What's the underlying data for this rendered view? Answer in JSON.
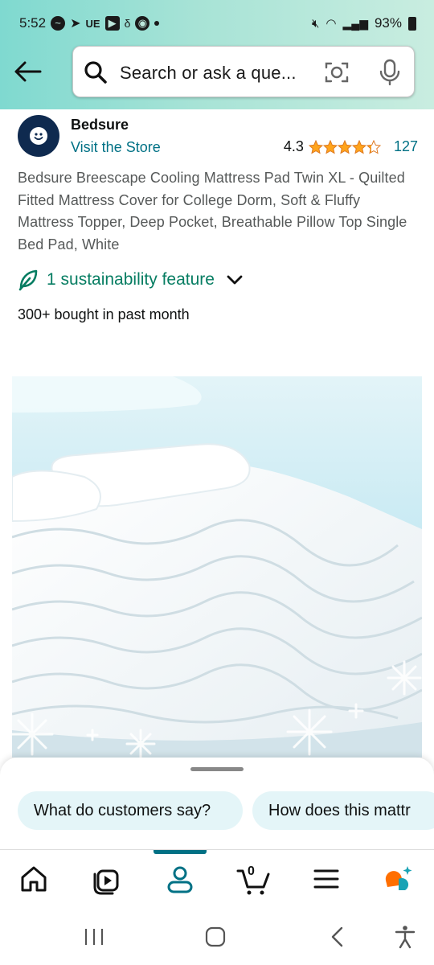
{
  "status_bar": {
    "time": "5:52",
    "ue_label": "UE",
    "battery": "93%"
  },
  "search": {
    "placeholder": "Search or ask a que..."
  },
  "brand": {
    "name": "Bedsure",
    "visit_store": "Visit the Store",
    "rating_value": "4.3",
    "rating_stars": 4.3,
    "review_count": "127"
  },
  "product": {
    "title": "Bedsure Breescape Cooling Mattress Pad Twin XL - Quilted Fitted Mattress Cover for College Dorm, Soft & Fluffy Mattress Topper, Deep Pocket, Breathable Pillow Top Single Bed Pad, White",
    "sustainability": "1 sustainability feature",
    "bought": "300+ bought in past month"
  },
  "questions": {
    "chip1": "What do customers say?",
    "chip2": "How does this mattr"
  },
  "bottom_nav": {
    "cart_count": "0",
    "active_tab": "account"
  },
  "colors": {
    "link": "#007185",
    "sustain": "#067d62",
    "star": "#ffa41c",
    "header_gradient_start": "#7fd9d0",
    "chip_bg": "#e4f5f8"
  }
}
